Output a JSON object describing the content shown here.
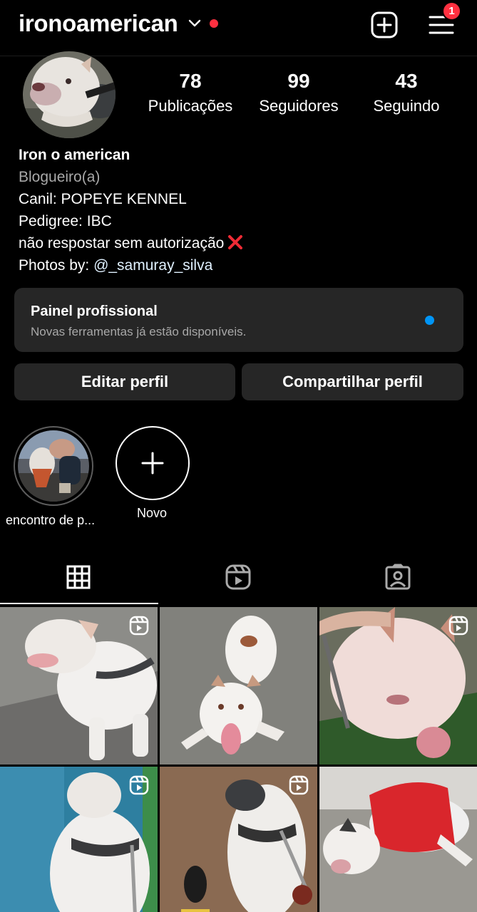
{
  "header": {
    "username": "ironoamerican",
    "notifications_badge": "1",
    "icons": [
      "chevron-down-icon",
      "create-post-icon",
      "menu-icon"
    ]
  },
  "stats": [
    {
      "value": "78",
      "label": "Publicações"
    },
    {
      "value": "99",
      "label": "Seguidores"
    },
    {
      "value": "43",
      "label": "Seguindo"
    }
  ],
  "bio": {
    "name": "Iron o american",
    "category": "Blogueiro(a)",
    "line1": "Canil: POPEYE KENNEL",
    "line2": "Pedigree: IBC",
    "line3": "não respostar sem autorização",
    "line4_prefix": "Photos by: ",
    "line4_link": "@_samuray_silva"
  },
  "panel": {
    "title": "Painel profissional",
    "subtitle": "Novas ferramentas já estão disponíveis."
  },
  "actions": {
    "edit": "Editar perfil",
    "share": "Compartilhar perfil"
  },
  "highlights": [
    {
      "label": "encontro de p..."
    },
    {
      "label": "Novo"
    }
  ],
  "tabs": [
    "grid-icon",
    "reels-icon",
    "tagged-icon"
  ],
  "colors": {
    "accent_blue": "#0095f6",
    "badge_red": "#ff3040",
    "surface": "#262626",
    "muted_text": "#a8a8a8"
  }
}
